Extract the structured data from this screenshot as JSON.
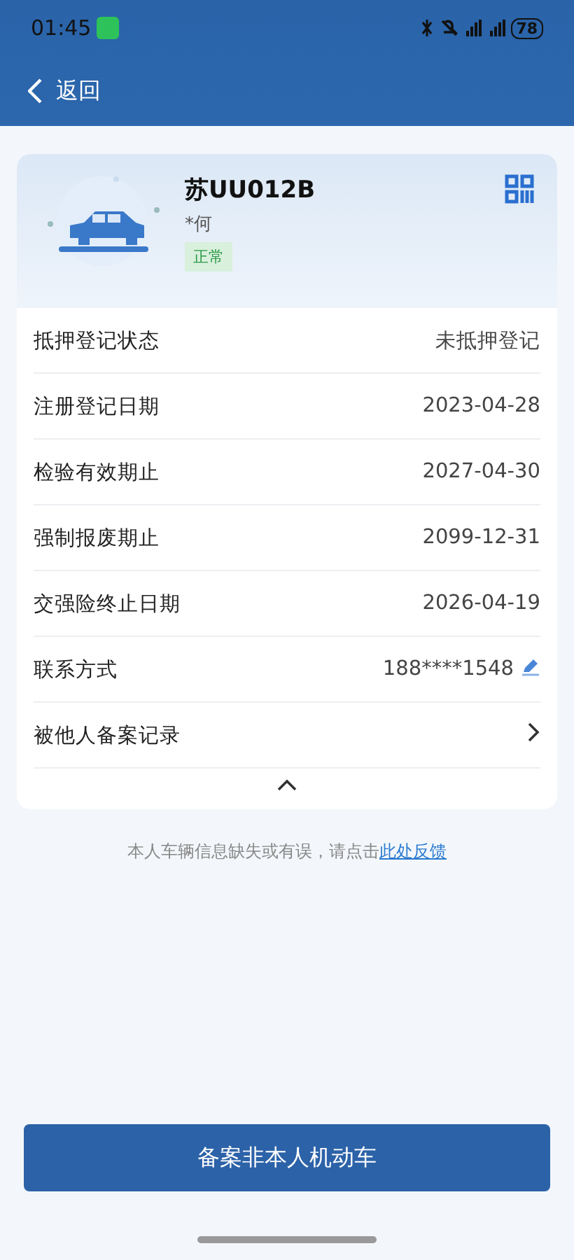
{
  "status_bar": {
    "time": "01:45",
    "battery": "78"
  },
  "nav": {
    "back_label": "返回"
  },
  "vehicle": {
    "plate": "苏UU012B",
    "owner": "*何",
    "status": "正常"
  },
  "rows": [
    {
      "kind": "text",
      "label": "抵押登记状态",
      "value": "未抵押登记"
    },
    {
      "kind": "text",
      "label": "注册登记日期",
      "value": "2023-04-28"
    },
    {
      "kind": "text",
      "label": "检验有效期止",
      "value": "2027-04-30"
    },
    {
      "kind": "text",
      "label": "强制报废期止",
      "value": "2099-12-31"
    },
    {
      "kind": "text",
      "label": "交强险终止日期",
      "value": "2026-04-19"
    },
    {
      "kind": "edit",
      "label": "联系方式",
      "value": "188****1548"
    },
    {
      "kind": "link",
      "label": "被他人备案记录"
    }
  ],
  "collapse": {
    "expanded": true
  },
  "feedback": {
    "text": "本人车辆信息缺失或有误，请点击",
    "link": "此处反馈"
  },
  "primary_button": "备案非本人机动车"
}
